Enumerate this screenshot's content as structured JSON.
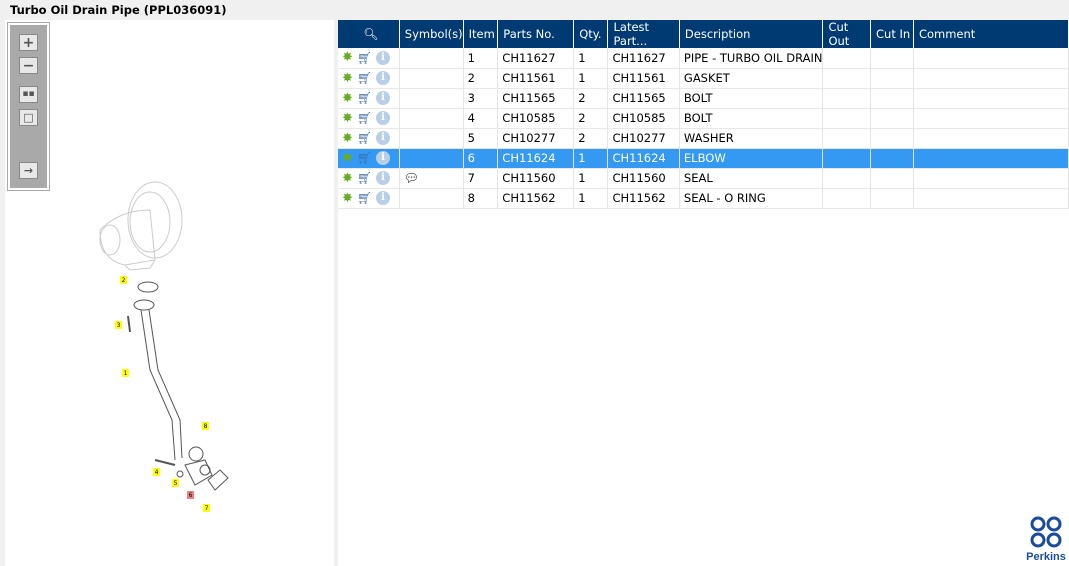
{
  "title": "Turbo Oil Drain Pipe (PPL036091)",
  "toolbar": {
    "zoom_in": "+",
    "zoom_out": "−"
  },
  "table": {
    "headers": [
      "",
      "Symbol(s)",
      "Item",
      "Parts No.",
      "Qty.",
      "Latest Part...",
      "Description",
      "Cut Out",
      "Cut In",
      "Comment"
    ],
    "rows": [
      {
        "item": "1",
        "part": "CH11627",
        "qty": "1",
        "latest": "CH11627",
        "desc": "PIPE - TURBO OIL DRAIN",
        "symbol": ""
      },
      {
        "item": "2",
        "part": "CH11561",
        "qty": "1",
        "latest": "CH11561",
        "desc": "GASKET",
        "symbol": ""
      },
      {
        "item": "3",
        "part": "CH11565",
        "qty": "2",
        "latest": "CH11565",
        "desc": "BOLT",
        "symbol": ""
      },
      {
        "item": "4",
        "part": "CH10585",
        "qty": "2",
        "latest": "CH10585",
        "desc": "BOLT",
        "symbol": ""
      },
      {
        "item": "5",
        "part": "CH10277",
        "qty": "2",
        "latest": "CH10277",
        "desc": "WASHER",
        "symbol": ""
      },
      {
        "item": "6",
        "part": "CH11624",
        "qty": "1",
        "latest": "CH11624",
        "desc": "ELBOW",
        "symbol": ""
      },
      {
        "item": "7",
        "part": "CH11560",
        "qty": "1",
        "latest": "CH11560",
        "desc": "SEAL",
        "symbol": "comment-icon"
      },
      {
        "item": "8",
        "part": "CH11562",
        "qty": "1",
        "latest": "CH11562",
        "desc": "SEAL - O RING",
        "symbol": ""
      }
    ],
    "selected_item": "6"
  },
  "callouts": [
    "1",
    "2",
    "3",
    "4",
    "5",
    "6",
    "7",
    "8"
  ],
  "logo": "Perkins",
  "colors": {
    "header": "#003a73",
    "selected": "#3399f3",
    "callout": "#ffff00",
    "callout_selected": "#f08080"
  }
}
